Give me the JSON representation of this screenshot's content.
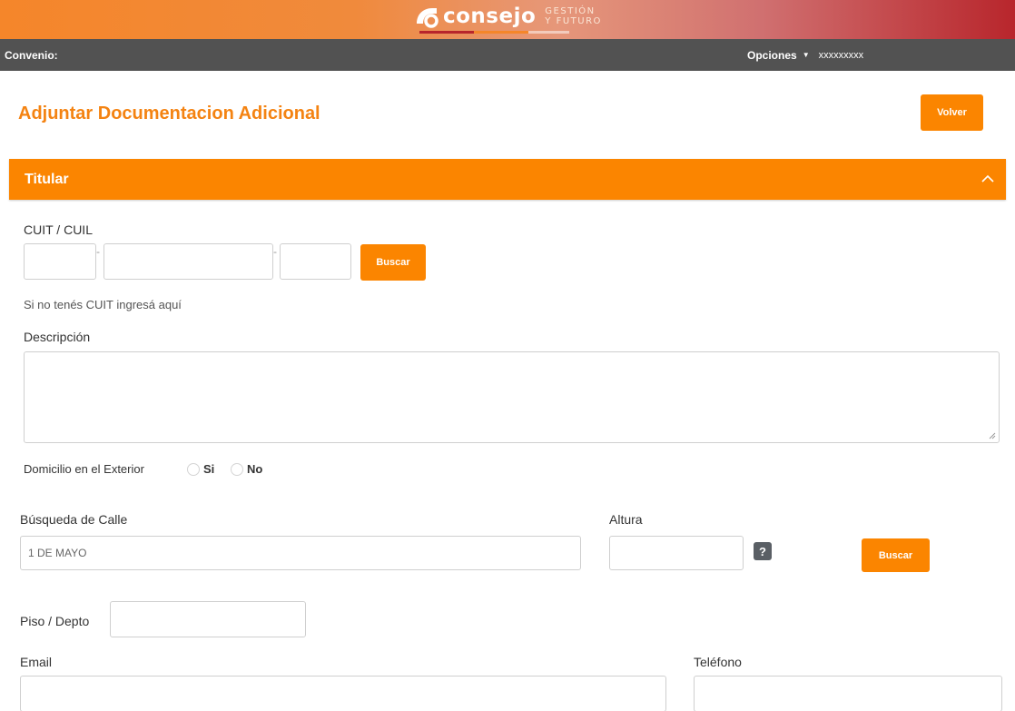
{
  "header": {
    "logo_name": "consejo",
    "logo_sub_line1": "GESTIÓN",
    "logo_sub_line2": "Y FUTURO",
    "colors": {
      "orange": "#f5862a",
      "red": "#b8262c"
    }
  },
  "navbar": {
    "convenio_label": "Convenio:",
    "opciones_label": "Opciones",
    "opciones_icon": "caret-down-icon",
    "user": "xxxxxxxxx"
  },
  "page": {
    "title": "Adjuntar Documentacion Adicional",
    "volver_label": "Volver",
    "accent_color": "#fb8500"
  },
  "section": {
    "title": "Titular",
    "toggle_icon": "chevron-up-icon"
  },
  "form": {
    "cuit_label": "CUIT / CUIL",
    "cuit_part1": "",
    "cuit_part2": "",
    "cuit_part3": "",
    "cuit_separator": "-",
    "buscar_label": "Buscar",
    "no_cuit_text": "Si no tenés CUIT ingresá aquí",
    "descripcion_label": "Descripción",
    "descripcion_value": "",
    "domicilio_label": "Domicilio en el Exterior",
    "domicilio_options": [
      "Si",
      "No"
    ],
    "calle_label": "Búsqueda de Calle",
    "calle_value": "1 DE MAYO",
    "altura_label": "Altura",
    "altura_value": "",
    "help_label": "?",
    "buscar_label_2": "Buscar",
    "piso_label": "Piso / Depto",
    "piso_value": "",
    "email_label": "Email",
    "email_value": "",
    "telefono_label": "Teléfono",
    "telefono_value": ""
  }
}
